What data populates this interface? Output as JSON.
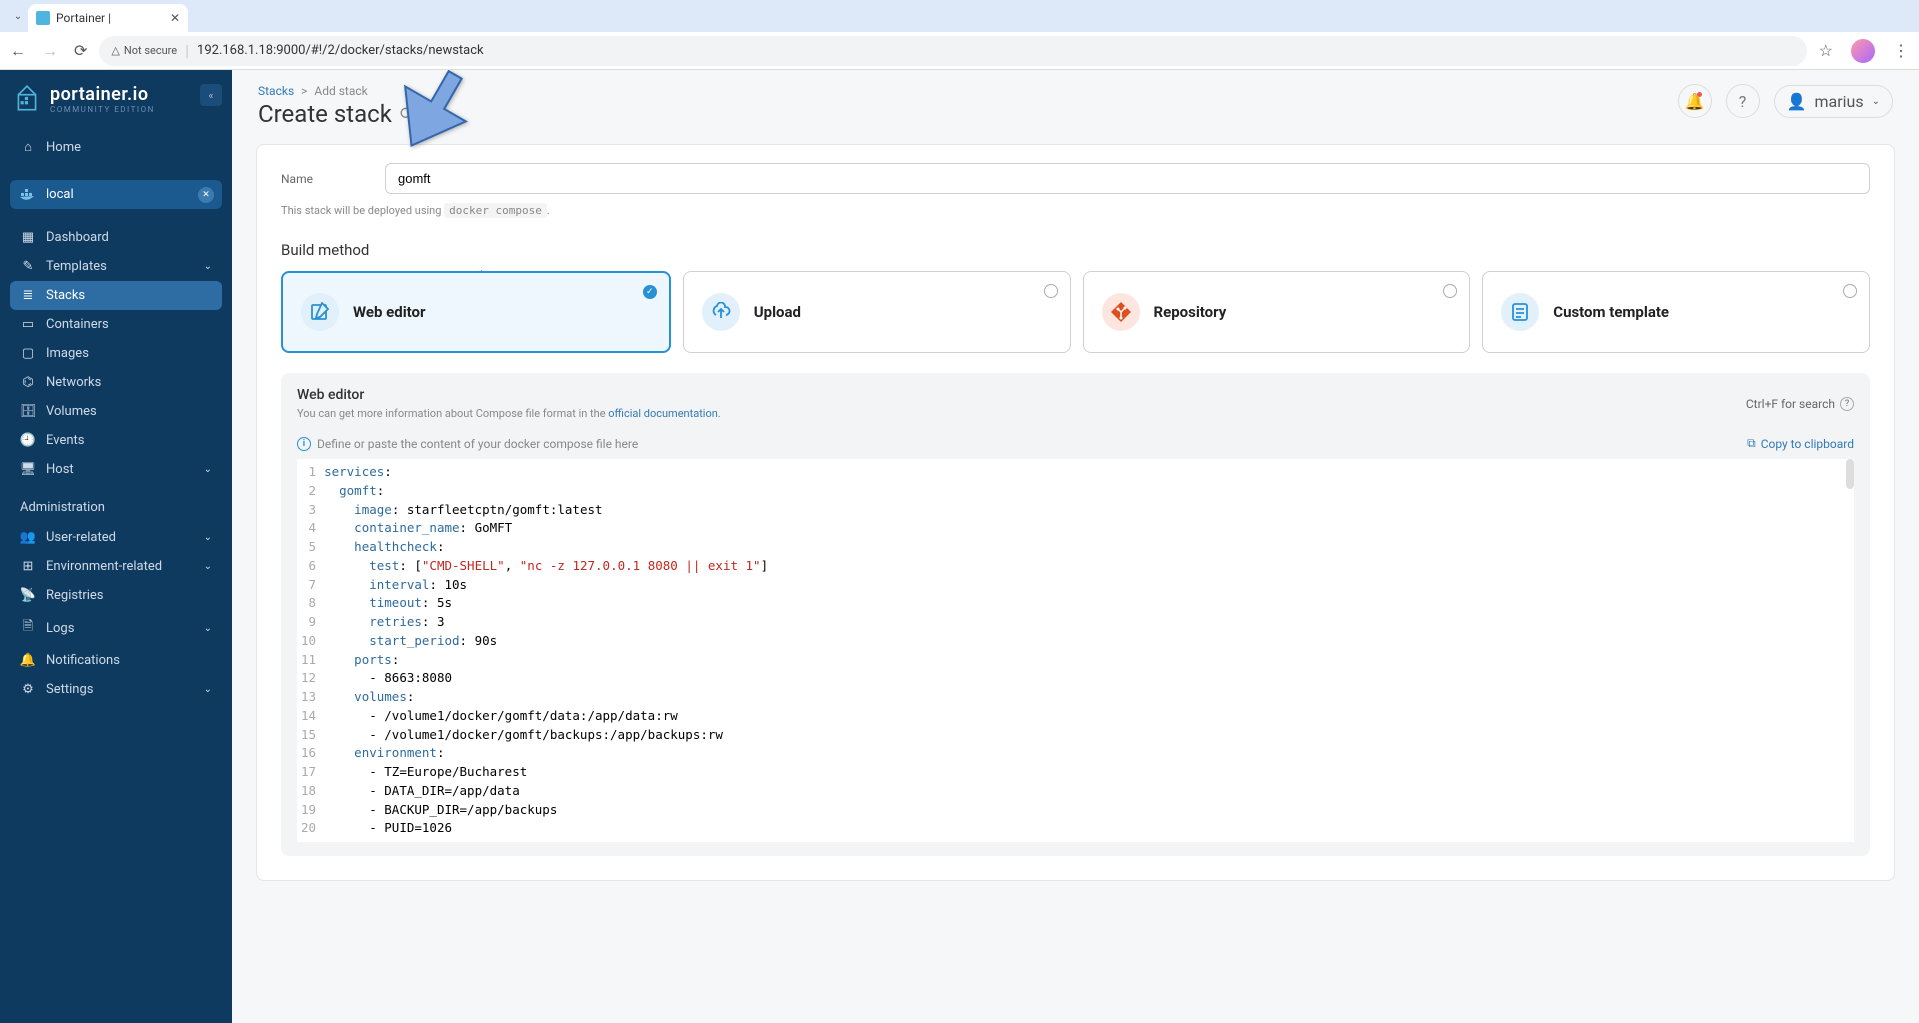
{
  "browser": {
    "tab_title": "Portainer |",
    "security_label": "Not secure",
    "url": "192.168.1.18:9000/#!/2/docker/stacks/newstack"
  },
  "sidebar": {
    "brand": "portainer.io",
    "edition": "COMMUNITY EDITION",
    "collapse_glyph": "«",
    "home": "Home",
    "env_name": "local",
    "items": [
      {
        "label": "Dashboard"
      },
      {
        "label": "Templates",
        "has_children": true
      },
      {
        "label": "Stacks",
        "active": true
      },
      {
        "label": "Containers"
      },
      {
        "label": "Images"
      },
      {
        "label": "Networks"
      },
      {
        "label": "Volumes"
      },
      {
        "label": "Events"
      },
      {
        "label": "Host",
        "has_children": true
      }
    ],
    "admin_header": "Administration",
    "admin_items": [
      {
        "label": "User-related",
        "has_children": true
      },
      {
        "label": "Environment-related",
        "has_children": true
      },
      {
        "label": "Registries"
      },
      {
        "label": "Logs",
        "has_children": true
      },
      {
        "label": "Notifications"
      },
      {
        "label": "Settings",
        "has_children": true
      }
    ]
  },
  "header": {
    "breadcrumb_link": "Stacks",
    "breadcrumb_sep": ">",
    "breadcrumb_current": "Add stack",
    "title": "Create stack",
    "username": "marius"
  },
  "form": {
    "name_label": "Name",
    "name_value": "gomft",
    "deploy_note_prefix": "This stack will be deployed using ",
    "deploy_note_code": "docker compose",
    "deploy_note_suffix": "."
  },
  "build": {
    "section_title": "Build method",
    "methods": [
      {
        "label": "Web editor",
        "selected": true
      },
      {
        "label": "Upload"
      },
      {
        "label": "Repository"
      },
      {
        "label": "Custom template"
      }
    ]
  },
  "editor": {
    "title": "Web editor",
    "help_prefix": "You can get more information about Compose file format in the ",
    "help_link_text": "official documentation",
    "help_suffix": ".",
    "search_hint": "Ctrl+F for search",
    "compose_hint": "Define or paste the content of your docker compose file here",
    "copy_label": "Copy to clipboard",
    "code_lines": [
      {
        "n": 1,
        "indent": 0,
        "key": "services",
        "rest": ":"
      },
      {
        "n": 2,
        "indent": 1,
        "key": "gomft",
        "rest": ":"
      },
      {
        "n": 3,
        "indent": 2,
        "key": "image",
        "rest": ": starfleetcptn/gomft:latest"
      },
      {
        "n": 4,
        "indent": 2,
        "key": "container_name",
        "rest": ": GoMFT"
      },
      {
        "n": 5,
        "indent": 2,
        "key": "healthcheck",
        "rest": ":"
      },
      {
        "n": 6,
        "indent": 3,
        "key": "test",
        "rest_tokens": [
          ": [",
          {
            "t": "hl",
            "v": "\"CMD-SHELL\""
          },
          ", ",
          {
            "t": "hl",
            "v": "\"nc -z 127.0.0.1 8080 || exit 1\""
          },
          "]"
        ]
      },
      {
        "n": 7,
        "indent": 3,
        "key": "interval",
        "rest": ": 10s"
      },
      {
        "n": 8,
        "indent": 3,
        "key": "timeout",
        "rest": ": 5s"
      },
      {
        "n": 9,
        "indent": 3,
        "key": "retries",
        "rest": ": 3"
      },
      {
        "n": 10,
        "indent": 3,
        "key": "start_period",
        "rest": ": 90s"
      },
      {
        "n": 11,
        "indent": 2,
        "key": "ports",
        "rest": ":"
      },
      {
        "n": 12,
        "indent": 3,
        "plain": "- 8663:8080"
      },
      {
        "n": 13,
        "indent": 2,
        "key": "volumes",
        "rest": ":"
      },
      {
        "n": 14,
        "indent": 3,
        "plain": "- /volume1/docker/gomft/data:/app/data:rw"
      },
      {
        "n": 15,
        "indent": 3,
        "plain": "- /volume1/docker/gomft/backups:/app/backups:rw"
      },
      {
        "n": 16,
        "indent": 2,
        "key": "environment",
        "rest": ":"
      },
      {
        "n": 17,
        "indent": 3,
        "plain": "- TZ=Europe/Bucharest"
      },
      {
        "n": 18,
        "indent": 3,
        "plain": "- DATA_DIR=/app/data"
      },
      {
        "n": 19,
        "indent": 3,
        "plain": "- BACKUP_DIR=/app/backups"
      },
      {
        "n": 20,
        "indent": 3,
        "plain": "- PUID=1026"
      }
    ]
  }
}
